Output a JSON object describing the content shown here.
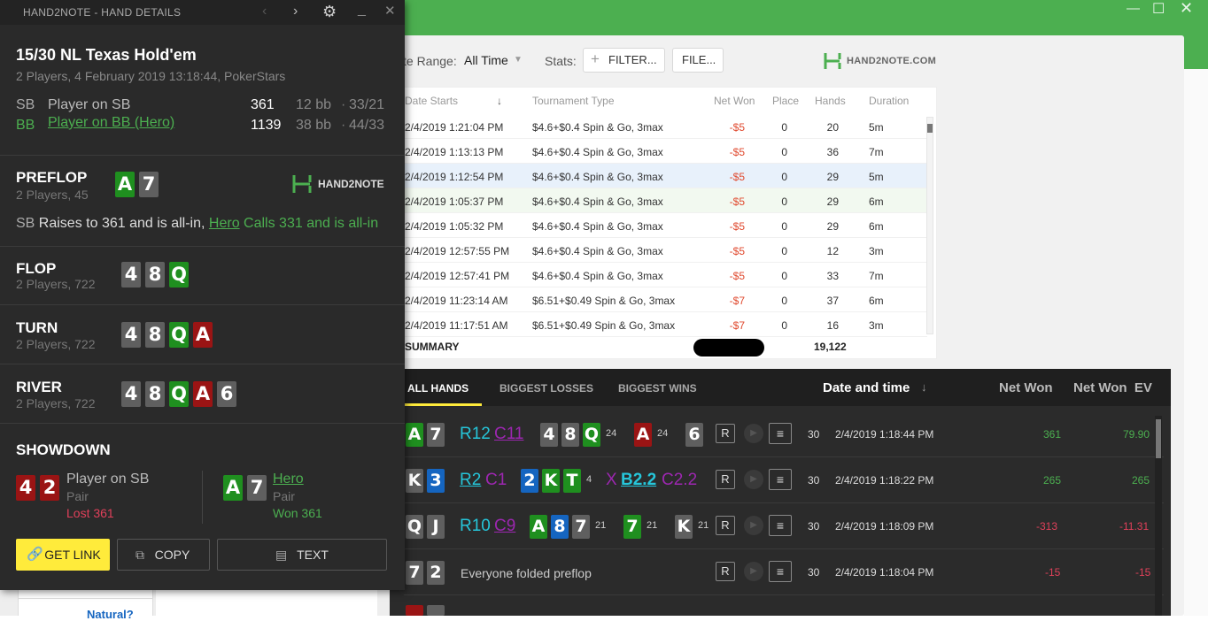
{
  "background": {
    "filters": {
      "date_range_label": "te Range:",
      "date_range_value": "All Time",
      "stats_label": "Stats:",
      "filter_button": "FILTER...",
      "file_button": "FILE...",
      "logo_text": "HAND2NOTE.COM"
    },
    "tournament_table": {
      "headers": [
        "Date Starts",
        "Tournament Type",
        "Net Won",
        "Place",
        "Hands",
        "Duration"
      ],
      "rows": [
        [
          "2/4/2019 1:21:04 PM",
          "$4.6+$0.4 Spin & Go, 3max",
          "-$5",
          "0",
          "20",
          "5m"
        ],
        [
          "2/4/2019 1:13:13 PM",
          "$4.6+$0.4 Spin & Go, 3max",
          "-$5",
          "0",
          "36",
          "7m"
        ],
        [
          "2/4/2019 1:12:54 PM",
          "$4.6+$0.4 Spin & Go, 3max",
          "-$5",
          "0",
          "29",
          "5m"
        ],
        [
          "2/4/2019 1:05:37 PM",
          "$4.6+$0.4 Spin & Go, 3max",
          "-$5",
          "0",
          "29",
          "6m"
        ],
        [
          "2/4/2019 1:05:32 PM",
          "$4.6+$0.4 Spin & Go, 3max",
          "-$5",
          "0",
          "29",
          "6m"
        ],
        [
          "2/4/2019 12:57:55 PM",
          "$4.6+$0.4 Spin & Go, 3max",
          "-$5",
          "0",
          "12",
          "3m"
        ],
        [
          "2/4/2019 12:57:41 PM",
          "$4.6+$0.4 Spin & Go, 3max",
          "-$5",
          "0",
          "33",
          "7m"
        ],
        [
          "2/4/2019 11:23:14 AM",
          "$6.51+$0.49 Spin & Go, 3max",
          "-$7",
          "0",
          "37",
          "6m"
        ],
        [
          "2/4/2019 11:17:51 AM",
          "$6.51+$0.49 Spin & Go, 3max",
          "-$7",
          "0",
          "16",
          "3m"
        ]
      ],
      "summary_label": "SUMMARY",
      "summary_hands": "19,122"
    },
    "hands_tabs": [
      "ALL HANDS",
      "BIGGEST LOSSES",
      "BIGGEST WINS"
    ],
    "hands_columns": {
      "date": "Date and time",
      "net": "Net Won",
      "net_ev": "Net Won  EV"
    },
    "hands": [
      {
        "bb": "30",
        "date": "2/4/2019 1:18:44 PM",
        "net": "361",
        "ev": "79.90"
      },
      {
        "bb": "30",
        "date": "2/4/2019 1:18:22 PM",
        "net": "265",
        "ev": "265"
      },
      {
        "bb": "30",
        "date": "2/4/2019 1:18:09 PM",
        "net": "-313",
        "ev": "-11.31"
      },
      {
        "bb": "30",
        "date": "2/4/2019 1:18:04 PM",
        "net": "-15",
        "ev": "-15"
      }
    ],
    "hand_row_texts": {
      "r1_action": "R12",
      "r1_action2": "C11",
      "r1_n1": "24",
      "r1_n2": "24",
      "r2_action": "R2",
      "r2_action2": "C1",
      "r2_n1": "4",
      "r2_x": "X",
      "r2_b": "B2.2",
      "r2_c": "C2.2",
      "r3_action": "R10",
      "r3_action2": "C9",
      "r3_n1": "21",
      "r3_n2": "21",
      "r3_n3": "21",
      "r4_text": "Everyone folded preflop",
      "r_button": "R"
    },
    "bottom_link": "Natural?"
  },
  "popup": {
    "title": "HAND2NOTE - HAND DETAILS",
    "game": "15/30 NL Texas Hold'em",
    "info": "2 Players, 4 February 2019 13:18:44, PokerStars",
    "players": [
      {
        "pos": "SB",
        "name": "Player on SB",
        "stack": "361",
        "bb": "12 bb",
        "sep": "·",
        "stat": "33/21"
      },
      {
        "pos": "BB",
        "name": "Player on BB (Hero)",
        "stack": "1139",
        "bb": "38 bb",
        "sep": "·",
        "stat": "44/33"
      }
    ],
    "preflop": {
      "name": "PREFLOP",
      "sub": "2 Players, 45",
      "logo": "HAND2NOTE",
      "action_sb": "SB",
      "action_sb_text": "Raises to 361 and is all-in,",
      "action_hero": "Hero",
      "action_hero_text": "Calls 331 and is all-in"
    },
    "flop": {
      "name": "FLOP",
      "sub": "2 Players, 722"
    },
    "turn": {
      "name": "TURN",
      "sub": "2 Players, 722"
    },
    "river": {
      "name": "RIVER",
      "sub": "2 Players, 722"
    },
    "showdown": {
      "name": "SHOWDOWN",
      "p1_name": "Player on SB",
      "p1_hand": "Pair",
      "p1_result": "Lost 361",
      "p2_name": "Hero",
      "p2_hand": "Pair",
      "p2_result": "Won 361"
    },
    "buttons": {
      "get_link": "GET LINK",
      "copy": "COPY",
      "text": "TEXT"
    }
  },
  "colors": {
    "green": "#1f8f1f",
    "grey": "#5f5f5f",
    "red": "#9a1414",
    "blue": "#1565c0",
    "accent": "#ffeb3b"
  }
}
